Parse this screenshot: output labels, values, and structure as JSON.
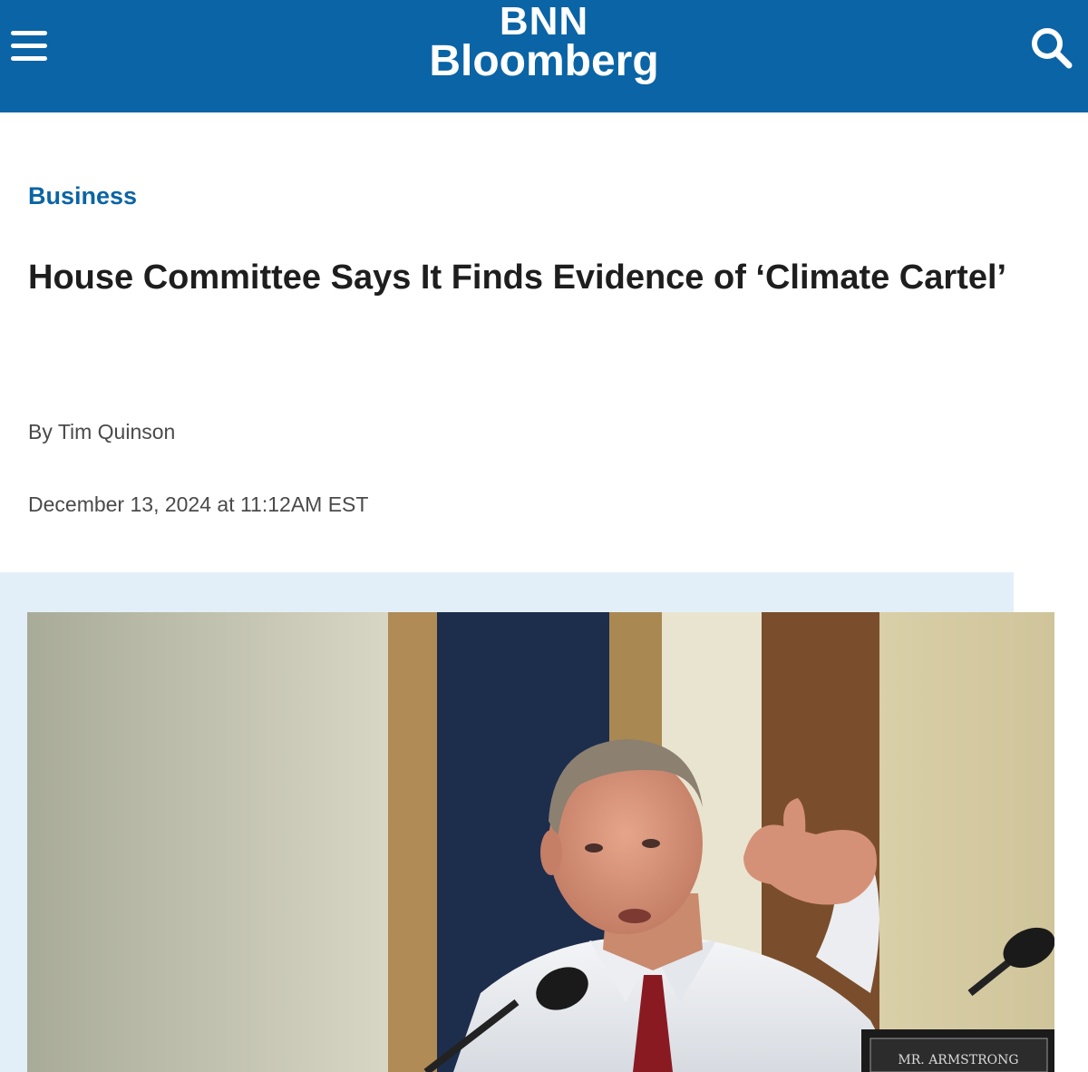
{
  "header": {
    "logo_line1": "BNN",
    "logo_line2": "Bloomberg",
    "bar_color": "#0a64a5",
    "menu_icon": "hamburger-menu-icon",
    "search_icon": "search-icon"
  },
  "article": {
    "category": "Business",
    "title": "House Committee Says It Finds Evidence of ‘Climate Cartel’",
    "byline": "By Tim Quinson",
    "date": "December 13, 2024 at 11:12AM EST",
    "image": {
      "nameplate_text": "MR. ARMSTRONG"
    }
  },
  "colors": {
    "accent": "#0a64a5",
    "image_backdrop": "#e3eff8",
    "headline": "#1e1e1e",
    "meta_text": "#4a4a4a"
  }
}
